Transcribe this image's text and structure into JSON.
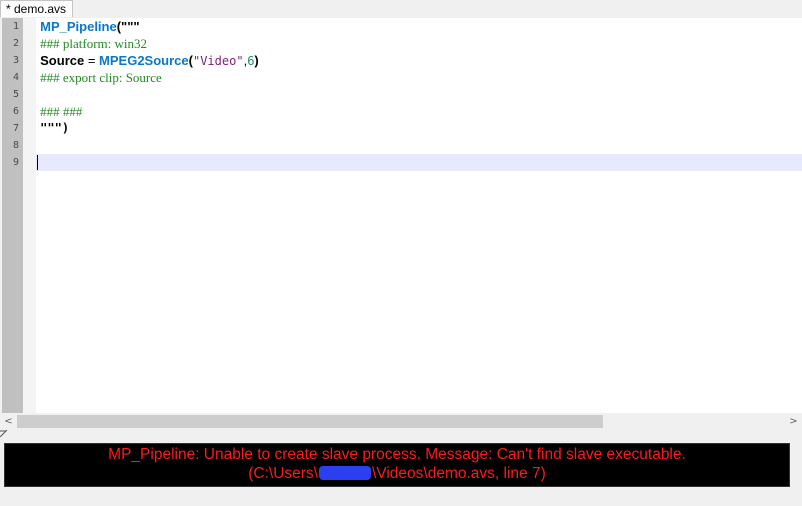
{
  "tab": {
    "label": "* demo.avs"
  },
  "editor": {
    "line_numbers": [
      "1",
      "2",
      "3",
      "4",
      "5",
      "6",
      "7",
      "8",
      "9"
    ],
    "current_line": 9,
    "lines": {
      "l1": {
        "call": "MP_Pipeline",
        "open": "(\"\"\""
      },
      "l2": {
        "comment": "### platform: win32"
      },
      "l3": {
        "lhs": "Source",
        "eq": " = ",
        "call": "MPEG2Source",
        "paren_open": "(",
        "str": "\"Video\"",
        "comma": ",",
        "num": "6",
        "paren_close": ")"
      },
      "l4": {
        "comment": "### export clip: Source"
      },
      "l5": {
        "text": ""
      },
      "l6": {
        "comment": "### ###"
      },
      "l7": {
        "text": "\"\"\")"
      },
      "l8": {
        "text": ""
      },
      "l9": {
        "text": ""
      }
    }
  },
  "scrollbar": {
    "left_arrow": "<",
    "right_arrow": ">"
  },
  "error": {
    "line1": "MP_Pipeline: Unable to create slave process. Message: Can't find slave executable.",
    "line2_prefix": "(C:\\Users\\",
    "line2_suffix": "\\Videos\\demo.avs, line 7)"
  },
  "colors": {
    "keyword": "#0a78c8",
    "comment": "#228b22",
    "string": "#7a1f7a",
    "number": "#1f8f5f",
    "error_text": "#ff1a1a",
    "error_bg": "#000000",
    "current_line_bg": "#e8e8ff",
    "redaction": "#2b3ff0"
  }
}
